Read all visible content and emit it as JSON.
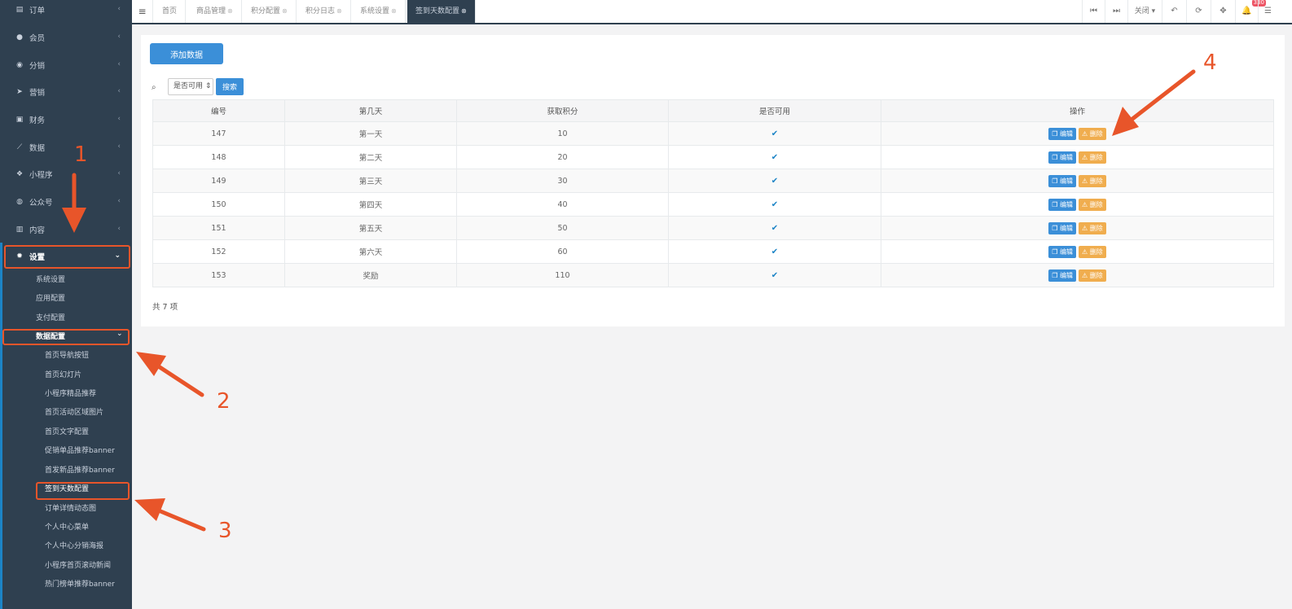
{
  "sidebar": {
    "items": [
      {
        "label": "订单",
        "icon": "clipboard-icon"
      },
      {
        "label": "会员",
        "icon": "user-icon"
      },
      {
        "label": "分销",
        "icon": "users-icon"
      },
      {
        "label": "营销",
        "icon": "paper-plane-icon"
      },
      {
        "label": "财务",
        "icon": "money-icon"
      },
      {
        "label": "数据",
        "icon": "line-chart-icon"
      },
      {
        "label": "小程序",
        "icon": "cubes-icon"
      },
      {
        "label": "公众号",
        "icon": "wechat-icon"
      },
      {
        "label": "内容",
        "icon": "book-icon"
      },
      {
        "label": "设置",
        "icon": "gear-icon"
      }
    ],
    "settings_children": [
      "系统设置",
      "应用配置",
      "支付配置",
      "数据配置"
    ],
    "data_config_children": [
      "首页导航按钮",
      "首页幻灯片",
      "小程序精品推荐",
      "首页活动区域图片",
      "首页文字配置",
      "促销单品推荐banner",
      "首发新品推荐banner",
      "签到天数配置",
      "订单详情动态图",
      "个人中心菜单",
      "个人中心分销海报",
      "小程序首页滚动新闻",
      "热门榜单推荐banner"
    ]
  },
  "tabs": [
    {
      "label": "首页",
      "closable": false
    },
    {
      "label": "商品管理",
      "closable": true
    },
    {
      "label": "积分配置",
      "closable": true
    },
    {
      "label": "积分日志",
      "closable": true
    },
    {
      "label": "系统设置",
      "closable": true
    },
    {
      "label": "签到天数配置",
      "closable": true,
      "active": true
    }
  ],
  "toolbar": {
    "close_label": "关闭",
    "notification_count": "330"
  },
  "panel": {
    "add_button": "添加数据",
    "filter_select": "是否可用",
    "search_button": "搜索",
    "total_text": "共 7 项"
  },
  "table": {
    "headers": [
      "编号",
      "第几天",
      "获取积分",
      "是否可用",
      "操作"
    ],
    "edit_label": "编辑",
    "delete_label": "删除",
    "rows": [
      {
        "id": "147",
        "day": "第一天",
        "points": "10",
        "enabled": true
      },
      {
        "id": "148",
        "day": "第二天",
        "points": "20",
        "enabled": true
      },
      {
        "id": "149",
        "day": "第三天",
        "points": "30",
        "enabled": true
      },
      {
        "id": "150",
        "day": "第四天",
        "points": "40",
        "enabled": true
      },
      {
        "id": "151",
        "day": "第五天",
        "points": "50",
        "enabled": true
      },
      {
        "id": "152",
        "day": "第六天",
        "points": "60",
        "enabled": true
      },
      {
        "id": "153",
        "day": "奖励",
        "points": "110",
        "enabled": true
      }
    ]
  },
  "annotations": {
    "n1": "1",
    "n2": "2",
    "n3": "3",
    "n4": "4",
    "color": "#e8552a"
  },
  "colors": {
    "sidebar_bg": "#2f4050",
    "primary": "#3b8fd8",
    "warning": "#f0ad4e"
  }
}
